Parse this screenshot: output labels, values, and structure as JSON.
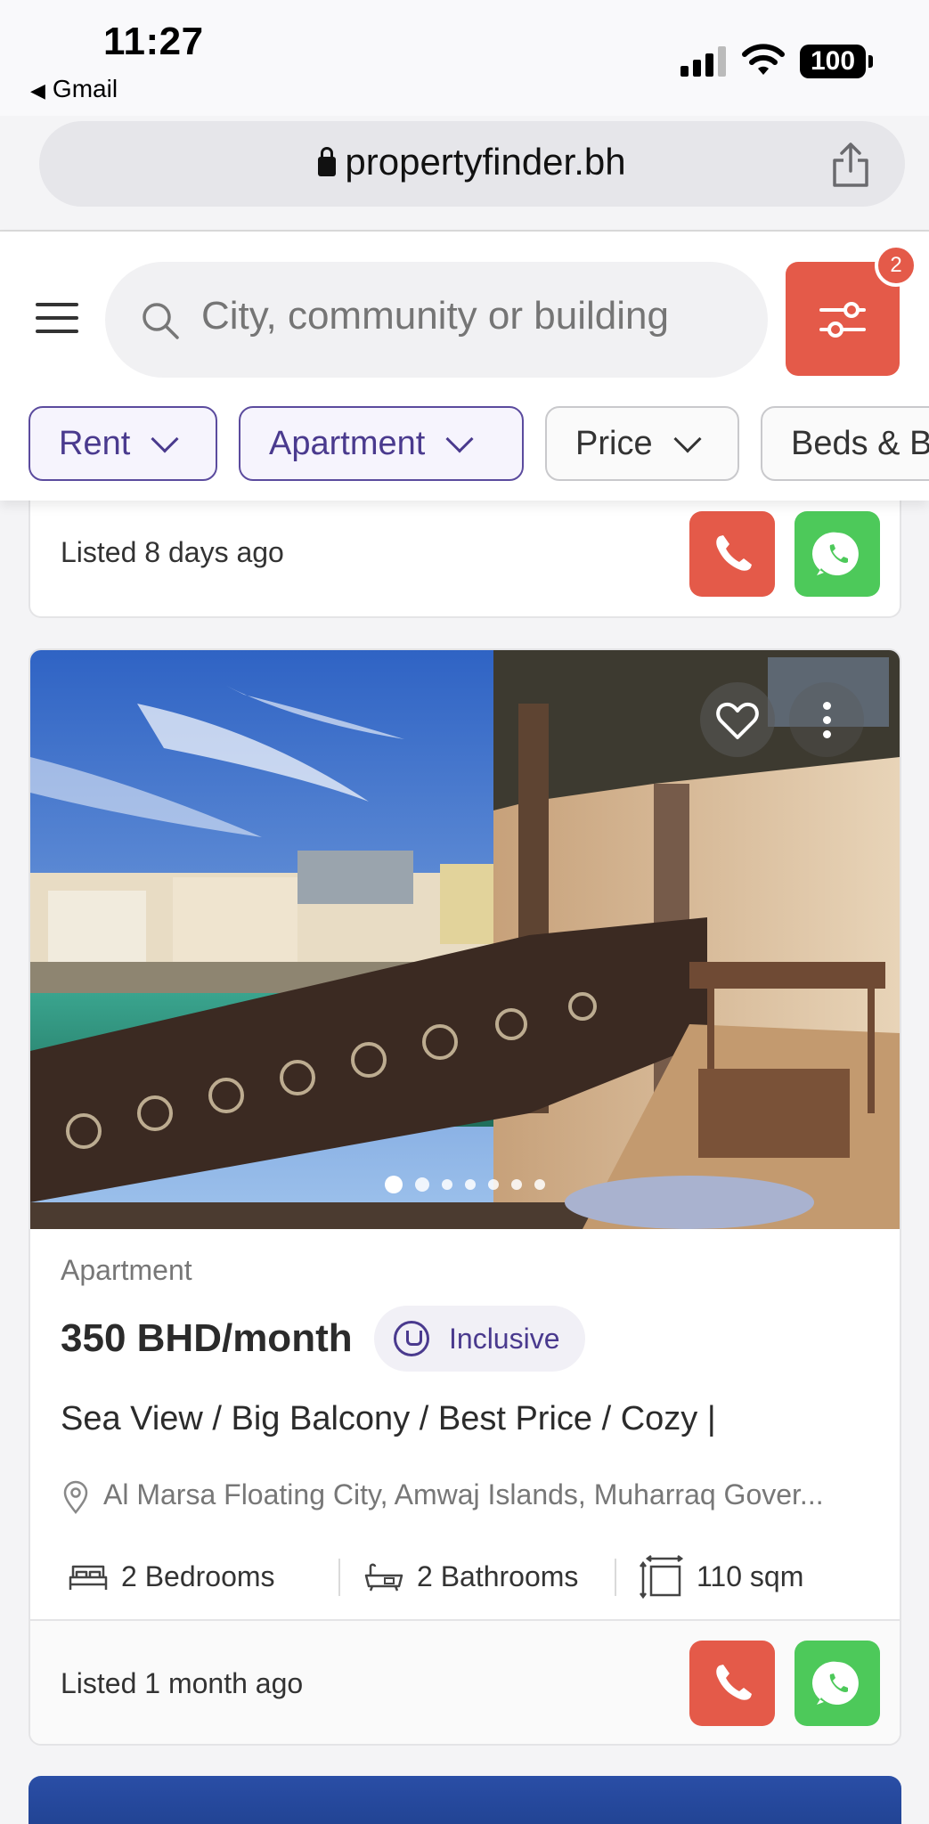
{
  "status_bar": {
    "time": "11:27",
    "back_app": "Gmail",
    "battery": "100"
  },
  "browser": {
    "url": "propertyfinder.bh"
  },
  "search": {
    "placeholder": "City, community or building",
    "filter_count": "2"
  },
  "filters": [
    {
      "label": "Rent",
      "active": true
    },
    {
      "label": "Apartment",
      "active": true
    },
    {
      "label": "Price",
      "active": false
    },
    {
      "label": "Beds & B",
      "active": false
    }
  ],
  "previous_card": {
    "listed": "Listed 8 days ago"
  },
  "listing": {
    "type": "Apartment",
    "price": "350 BHD/month",
    "price_tag": "Inclusive",
    "title": "Sea View / Big Balcony / Best Price / Cozy |",
    "location": "Al Marsa Floating City, Amwaj Islands, Muharraq Gover...",
    "bedrooms": "2 Bedrooms",
    "bathrooms": "2 Bathrooms",
    "area": "110 sqm",
    "listed": "Listed 1 month ago",
    "photo_count": 7,
    "current_photo": 1
  },
  "colors": {
    "accent": "#e45a49",
    "whatsapp": "#4dc95a",
    "brand": "#4a3a8e"
  }
}
